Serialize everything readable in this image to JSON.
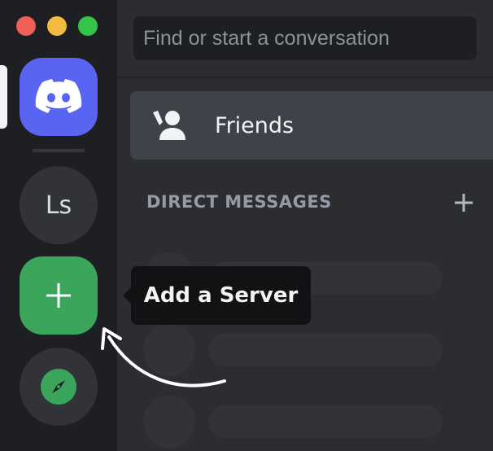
{
  "window": {
    "controls": [
      "close",
      "minimize",
      "maximize"
    ]
  },
  "server_rail": {
    "home": {
      "icon": "discord-logo-icon",
      "active": true
    },
    "servers": [
      {
        "label": "Ls"
      }
    ],
    "add_server": {
      "icon": "plus-icon"
    },
    "explore": {
      "icon": "compass-icon"
    }
  },
  "search": {
    "placeholder": "Find or start a conversation"
  },
  "friends": {
    "icon": "friends-icon",
    "label": "Friends"
  },
  "direct_messages": {
    "header": "DIRECT MESSAGES",
    "add_icon": "plus-icon"
  },
  "tooltip": {
    "text": "Add a Server"
  },
  "colors": {
    "rail_bg": "#1e1f22",
    "sidebar_bg": "#2b2d31",
    "blurple": "#5865f2",
    "green": "#3ba55c",
    "tooltip_bg": "#111214",
    "text_muted": "#949ba4",
    "text_normal": "#f2f3f5"
  }
}
